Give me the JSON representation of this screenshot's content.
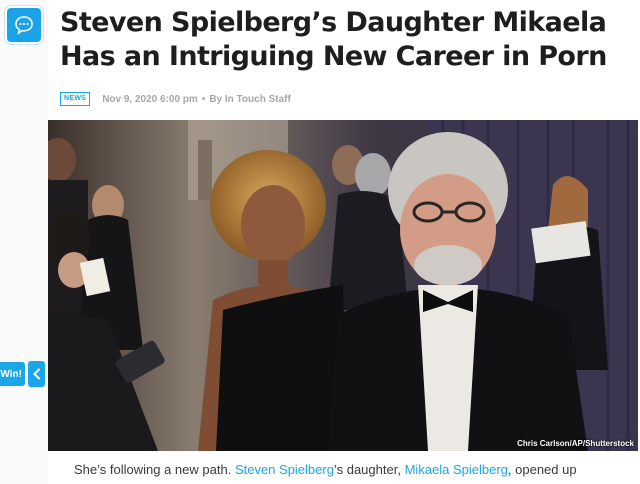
{
  "sidebar": {
    "chat_icon": "chat-bubble-icon",
    "win_label": "Win!",
    "collapse_icon": "chevron-left-icon"
  },
  "article": {
    "headline": "Steven Spielberg’s Daughter Mikaela Has an Intriguing New Career in Porn",
    "category": "NEWS",
    "date": "Nov 9, 2020 6:00 pm",
    "separator": "•",
    "byline": "By In Touch Staff",
    "photo_credit": "Chris Carlson/AP/Shutterstock",
    "body_intro": "She’s following a new path.",
    "link1": "Steven Spielberg",
    "body_mid": "’s daughter,",
    "link2": "Mikaela Spielberg",
    "body_end": ", opened up"
  },
  "colors": {
    "accent": "#19a7ea",
    "headline": "#1e1e1e",
    "meta": "#a7a7a7"
  }
}
